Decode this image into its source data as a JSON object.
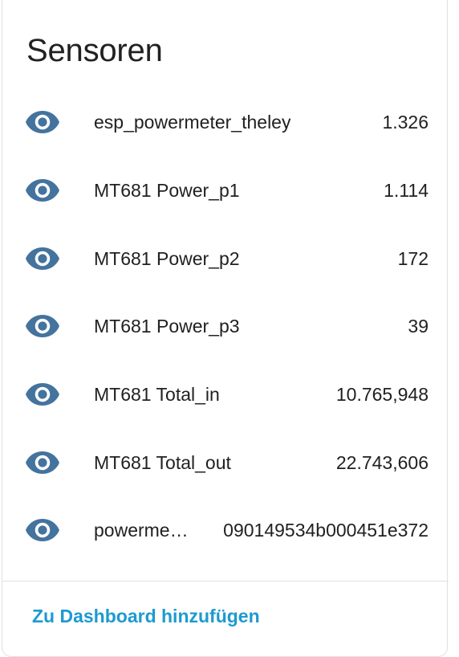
{
  "card": {
    "title": "Sensoren"
  },
  "entities": [
    {
      "icon": "eye-icon",
      "name": "esp_powermeter_theley",
      "value": "1.326"
    },
    {
      "icon": "eye-icon",
      "name": "MT681 Power_p1",
      "value": "1.114"
    },
    {
      "icon": "eye-icon",
      "name": "MT681 Power_p2",
      "value": "172"
    },
    {
      "icon": "eye-icon",
      "name": "MT681 Power_p3",
      "value": "39"
    },
    {
      "icon": "eye-icon",
      "name": "MT681 Total_in",
      "value": "10.765,948"
    },
    {
      "icon": "eye-icon",
      "name": "MT681 Total_out",
      "value": "22.743,606"
    },
    {
      "icon": "eye-icon",
      "name": "powerme…",
      "value": "090149534b000451e372"
    }
  ],
  "footer": {
    "add_to_dashboard_label": "Zu Dashboard hinzufügen"
  },
  "colors": {
    "icon": "#44739e",
    "accent": "#1d9ad0",
    "divider": "#e0e0e0"
  }
}
